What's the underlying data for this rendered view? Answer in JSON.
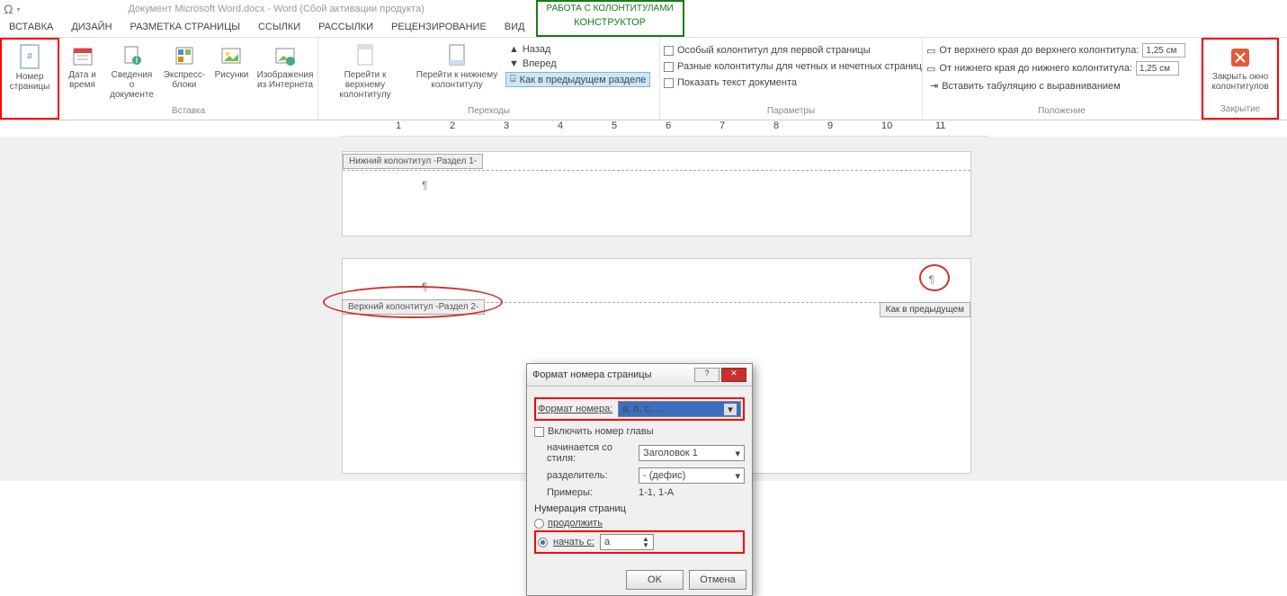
{
  "title": "Документ Microsoft Word.docx - Word (Сбой активации продукта)",
  "context_title": "РАБОТА С КОЛОНТИТУЛАМИ",
  "context_tab": "КОНСТРУКТОР",
  "tabs": [
    "ВСТАВКА",
    "ДИЗАЙН",
    "РАЗМЕТКА СТРАНИЦЫ",
    "ССЫЛКИ",
    "РАССЫЛКИ",
    "РЕЦЕНЗИРОВАНИЕ",
    "ВИД"
  ],
  "groups": {
    "hf": {
      "label": "",
      "page_number": "Номер страницы"
    },
    "insert": {
      "label": "Вставка",
      "date": "Дата и время",
      "docinfo": "Сведения о документе",
      "quick": "Экспресс-блоки",
      "pic": "Рисунки",
      "online": "Изображения из Интернета"
    },
    "nav": {
      "label": "Переходы",
      "goto_header": "Перейти к верхнему колонтитулу",
      "goto_footer": "Перейти к нижнему колонтитулу",
      "back": "Назад",
      "forward": "Вперед",
      "link": "Как в предыдущем разделе"
    },
    "options": {
      "label": "Параметры",
      "first": "Особый колонтитул для первой страницы",
      "oddeven": "Разные колонтитулы для четных и нечетных страниц",
      "showdoc": "Показать текст документа"
    },
    "position": {
      "label": "Положение",
      "top": "От верхнего края до верхнего колонтитула:",
      "bottom": "От нижнего края до нижнего колонтитула:",
      "tab": "Вставить табуляцию с выравниванием",
      "val": "1,25 см"
    },
    "close": {
      "label": "Закрытие",
      "btn": "Закрыть окно колонтитулов"
    }
  },
  "doc": {
    "footer_tag": "Нижний колонтитул -Раздел 1-",
    "header_tag": "Верхний колонтитул -Раздел 2-",
    "same_as_prev": "Как в предыдущем"
  },
  "dialog": {
    "title": "Формат номера страницы",
    "format_label": "Формат номера:",
    "format_value": "a, b, c, ...",
    "include_chapter": "Включить номер главы",
    "starts_style_label": "начинается со стиля:",
    "starts_style_value": "Заголовок 1",
    "separator_label": "разделитель:",
    "separator_value": "- (дефис)",
    "examples_label": "Примеры:",
    "examples_value": "1-1, 1-A",
    "numbering_title": "Нумерация страниц",
    "continue": "продолжить",
    "start_at": "начать с:",
    "start_value": "a",
    "ok": "OK",
    "cancel": "Отмена"
  }
}
